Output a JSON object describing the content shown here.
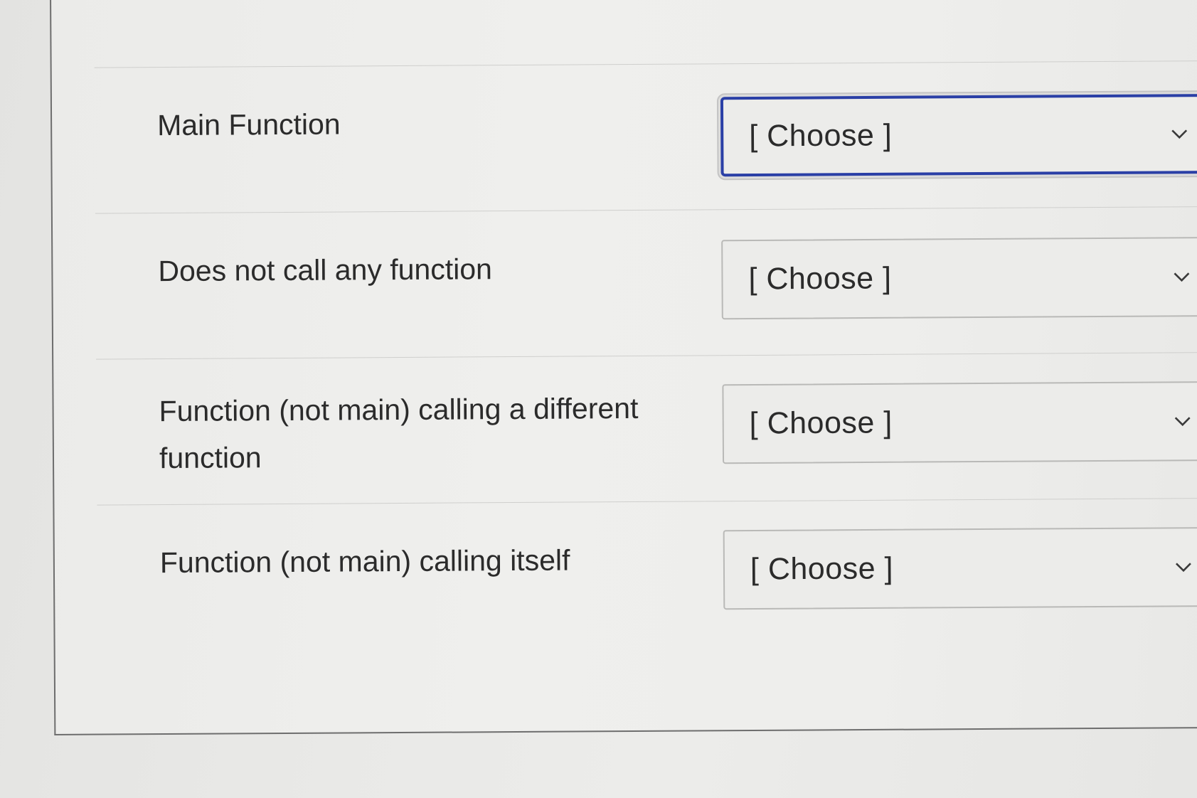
{
  "rows": [
    {
      "label": "Main Function",
      "select_value": "[ Choose ]",
      "focused": true
    },
    {
      "label": "Does not call any function",
      "select_value": "[ Choose ]",
      "focused": false
    },
    {
      "label": "Function (not main) calling a different function",
      "select_value": "[ Choose ]",
      "focused": false
    },
    {
      "label": "Function (not main) calling itself",
      "select_value": "[ Choose ]",
      "focused": false
    }
  ],
  "icons": {
    "dropdown": "chevron-down-icon"
  },
  "colors": {
    "focus_border": "#2a3fa6",
    "text": "#2b2b2b",
    "divider": "#cfcfcd"
  }
}
